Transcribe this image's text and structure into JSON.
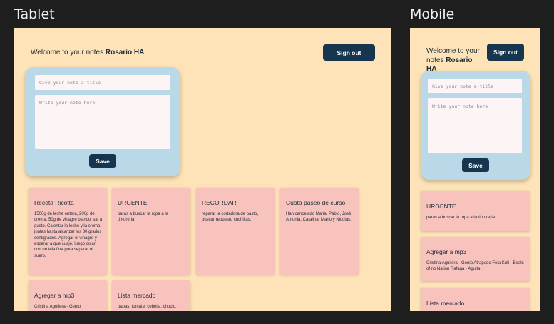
{
  "frames": {
    "tablet_label": "Tablet",
    "mobile_label": "Mobile"
  },
  "header": {
    "welcome_text": "Welcome to your notes",
    "user_name": "Rosario HA",
    "sign_out_label": "Sign out"
  },
  "form": {
    "title_placeholder": "Give your note a title",
    "body_placeholder": "Write your note here",
    "save_label": "Save"
  },
  "tablet_notes": [
    {
      "title": "Receta Ricotta",
      "body": "1500g de leche entera, 200g de crema, 50g de vinagre blanco, sal a gusto. Calentar la leche y la crema juntas hasta alcanzar los 80 grados centigrados. Agregar el vinagre y esperar a que cuaje, luego colar con un tela fina para separar el suero."
    },
    {
      "title": "URGENTE",
      "body": "paras a buscar la ropa a la tintoreria"
    },
    {
      "title": "RECORDAR",
      "body": "reparar la cortadora de pasto, buscar repuesto cuchillas."
    },
    {
      "title": "Cuota paseo de curso",
      "body": "Han cancelado Maria, Pablo, José, Antonia, Catalina, Mario y Nicolás."
    },
    {
      "title": "Agregar a mp3",
      "body": "Cristina Aguilera - Genio"
    },
    {
      "title": "Lista mercado",
      "body": "papas, tomate, cebolla, choclo,"
    }
  ],
  "mobile_notes": [
    {
      "title": "URGENTE",
      "body": "paras a buscar la ropa a la tintoreria"
    },
    {
      "title": "Agregar a mp3",
      "body": "Cristina Aguilera - Genio Atrapado Feia Kuti - Beats of no Nation Rafaga - Aguita"
    },
    {
      "title": "Lista mercado",
      "body": ""
    }
  ]
}
